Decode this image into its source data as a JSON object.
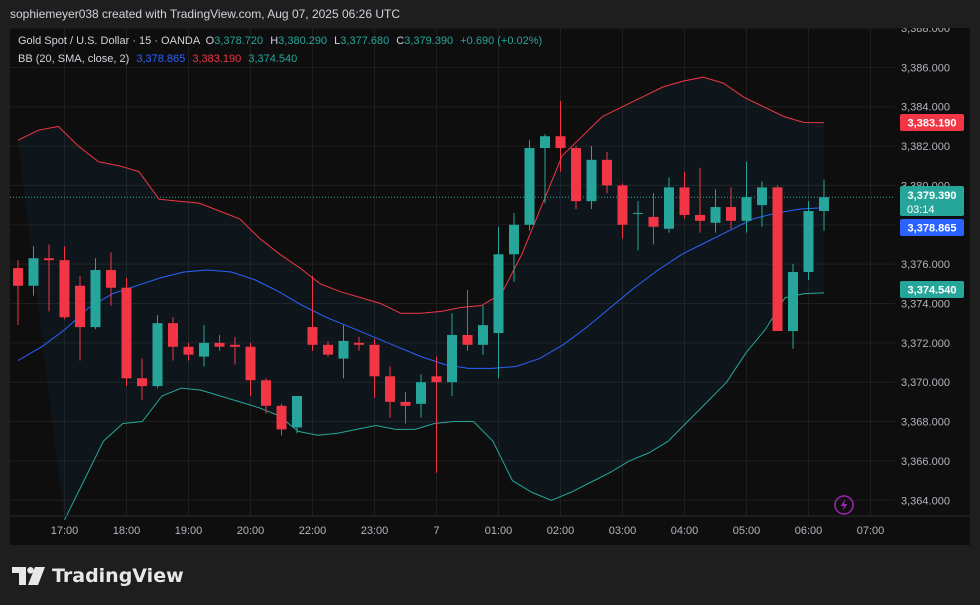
{
  "header": {
    "caption": "sophiemeyer038 created with TradingView.com, Aug 07, 2025 06:26 UTC"
  },
  "legend": {
    "symbol": "Gold Spot / U.S. Dollar · 15 · OANDA",
    "o_label": "O",
    "o_value": "3,378.720",
    "h_label": "H",
    "h_value": "3,380.290",
    "l_label": "L",
    "l_value": "3,377.680",
    "c_label": "C",
    "c_value": "3,379.390",
    "change": "+0.690 (+0.02%)",
    "bb_label": "BB (20, SMA, close, 2)",
    "bb_basis": "3,378.865",
    "bb_upper": "3,383.190",
    "bb_lower": "3,374.540"
  },
  "price_tags": {
    "upper": "3,383.190",
    "close": "3,379.390",
    "countdown": "03:14",
    "basis": "3,378.865",
    "lower": "3,374.540"
  },
  "colors": {
    "up": "#26a69a",
    "down": "#f23645",
    "basis": "#2962ff",
    "upper": "#f23645",
    "lower": "#26a69a",
    "axis_text": "#b2b5be",
    "flash_icon": "#9c27b0"
  },
  "footer": {
    "brand": "TradingView"
  },
  "chart_data": {
    "type": "candlestick",
    "y_ticks": [
      "3,364.000",
      "3,366.000",
      "3,368.000",
      "3,370.000",
      "3,372.000",
      "3,374.000",
      "3,376.000",
      "3,378.000",
      "3,380.000",
      "3,382.000",
      "3,384.000",
      "3,386.000",
      "3,388.000"
    ],
    "ylim": [
      3363.2,
      3388.0
    ],
    "x_ticks": [
      {
        "label": "17:00",
        "i": 3
      },
      {
        "label": "18:00",
        "i": 7
      },
      {
        "label": "19:00",
        "i": 11
      },
      {
        "label": "20:00",
        "i": 15
      },
      {
        "label": "22:00",
        "i": 19
      },
      {
        "label": "23:00",
        "i": 23
      },
      {
        "label": "7",
        "i": 27
      },
      {
        "label": "01:00",
        "i": 31
      },
      {
        "label": "02:00",
        "i": 35
      },
      {
        "label": "03:00",
        "i": 39
      },
      {
        "label": "04:00",
        "i": 43
      },
      {
        "label": "05:00",
        "i": 47
      },
      {
        "label": "06:00",
        "i": 51
      },
      {
        "label": "07:00",
        "i": 55
      }
    ],
    "candles": [
      {
        "o": 3375.8,
        "h": 3376.2,
        "l": 3372.9,
        "c": 3374.9
      },
      {
        "o": 3374.9,
        "h": 3376.9,
        "l": 3374.4,
        "c": 3376.3
      },
      {
        "o": 3376.3,
        "h": 3377.0,
        "l": 3373.6,
        "c": 3376.2
      },
      {
        "o": 3376.2,
        "h": 3376.9,
        "l": 3373.2,
        "c": 3373.3
      },
      {
        "o": 3374.9,
        "h": 3375.4,
        "l": 3371.1,
        "c": 3372.8
      },
      {
        "o": 3372.8,
        "h": 3376.3,
        "l": 3372.7,
        "c": 3375.7
      },
      {
        "o": 3375.7,
        "h": 3376.6,
        "l": 3373.9,
        "c": 3374.8
      },
      {
        "o": 3374.8,
        "h": 3375.3,
        "l": 3369.8,
        "c": 3370.2
      },
      {
        "o": 3370.2,
        "h": 3371.2,
        "l": 3369.1,
        "c": 3369.8
      },
      {
        "o": 3369.8,
        "h": 3373.4,
        "l": 3369.7,
        "c": 3373.0
      },
      {
        "o": 3373.0,
        "h": 3373.3,
        "l": 3371.1,
        "c": 3371.8
      },
      {
        "o": 3371.8,
        "h": 3372.0,
        "l": 3371.1,
        "c": 3371.4
      },
      {
        "o": 3371.3,
        "h": 3372.9,
        "l": 3370.8,
        "c": 3372.0
      },
      {
        "o": 3372.0,
        "h": 3372.4,
        "l": 3371.6,
        "c": 3371.8
      },
      {
        "o": 3371.9,
        "h": 3372.3,
        "l": 3370.9,
        "c": 3371.8
      },
      {
        "o": 3371.8,
        "h": 3372.0,
        "l": 3369.3,
        "c": 3370.1
      },
      {
        "o": 3370.1,
        "h": 3370.2,
        "l": 3368.4,
        "c": 3368.8
      },
      {
        "o": 3368.8,
        "h": 3368.9,
        "l": 3367.3,
        "c": 3367.6
      },
      {
        "o": 3367.7,
        "h": 3369.3,
        "l": 3367.4,
        "c": 3369.3
      },
      {
        "o": 3372.8,
        "h": 3375.4,
        "l": 3371.6,
        "c": 3371.9
      },
      {
        "o": 3371.9,
        "h": 3372.1,
        "l": 3371.3,
        "c": 3371.4
      },
      {
        "o": 3371.2,
        "h": 3372.9,
        "l": 3370.2,
        "c": 3372.1
      },
      {
        "o": 3372.0,
        "h": 3372.3,
        "l": 3371.6,
        "c": 3371.9
      },
      {
        "o": 3371.9,
        "h": 3372.2,
        "l": 3369.2,
        "c": 3370.3
      },
      {
        "o": 3370.3,
        "h": 3370.8,
        "l": 3368.2,
        "c": 3369.0
      },
      {
        "o": 3369.0,
        "h": 3369.5,
        "l": 3367.9,
        "c": 3368.8
      },
      {
        "o": 3368.9,
        "h": 3370.4,
        "l": 3368.2,
        "c": 3370.0
      },
      {
        "o": 3370.3,
        "h": 3371.3,
        "l": 3365.4,
        "c": 3370.0
      },
      {
        "o": 3370.0,
        "h": 3373.5,
        "l": 3369.3,
        "c": 3372.4
      },
      {
        "o": 3372.4,
        "h": 3374.7,
        "l": 3371.6,
        "c": 3371.9
      },
      {
        "o": 3371.9,
        "h": 3373.9,
        "l": 3371.4,
        "c": 3372.9
      },
      {
        "o": 3372.5,
        "h": 3377.9,
        "l": 3370.2,
        "c": 3376.5
      },
      {
        "o": 3376.5,
        "h": 3378.6,
        "l": 3375.1,
        "c": 3378.0
      },
      {
        "o": 3378.0,
        "h": 3382.3,
        "l": 3377.7,
        "c": 3381.9
      },
      {
        "o": 3381.9,
        "h": 3382.6,
        "l": 3379.1,
        "c": 3382.5
      },
      {
        "o": 3382.5,
        "h": 3384.3,
        "l": 3380.7,
        "c": 3381.9
      },
      {
        "o": 3381.9,
        "h": 3382.0,
        "l": 3378.8,
        "c": 3379.2
      },
      {
        "o": 3379.2,
        "h": 3382.0,
        "l": 3378.8,
        "c": 3381.3
      },
      {
        "o": 3381.3,
        "h": 3381.7,
        "l": 3379.6,
        "c": 3380.0
      },
      {
        "o": 3380.0,
        "h": 3380.1,
        "l": 3377.3,
        "c": 3378.0
      },
      {
        "o": 3378.6,
        "h": 3379.2,
        "l": 3376.7,
        "c": 3378.6
      },
      {
        "o": 3378.4,
        "h": 3379.6,
        "l": 3377.0,
        "c": 3377.9
      },
      {
        "o": 3377.8,
        "h": 3380.4,
        "l": 3377.6,
        "c": 3379.9
      },
      {
        "o": 3379.9,
        "h": 3380.7,
        "l": 3378.3,
        "c": 3378.5
      },
      {
        "o": 3378.5,
        "h": 3380.9,
        "l": 3377.6,
        "c": 3378.2
      },
      {
        "o": 3378.1,
        "h": 3379.8,
        "l": 3377.6,
        "c": 3378.9
      },
      {
        "o": 3378.9,
        "h": 3379.9,
        "l": 3377.8,
        "c": 3378.2
      },
      {
        "o": 3378.2,
        "h": 3381.2,
        "l": 3377.6,
        "c": 3379.4
      },
      {
        "o": 3379.0,
        "h": 3380.2,
        "l": 3377.9,
        "c": 3379.9
      },
      {
        "o": 3379.9,
        "h": 3380.0,
        "l": 3372.6,
        "c": 3372.6
      },
      {
        "o": 3372.6,
        "h": 3376.0,
        "l": 3371.7,
        "c": 3375.6
      },
      {
        "o": 3375.6,
        "h": 3379.2,
        "l": 3375.2,
        "c": 3378.7
      },
      {
        "o": 3378.7,
        "h": 3380.3,
        "l": 3377.7,
        "c": 3379.4
      }
    ],
    "bb_upper_approx": [
      3382.3,
      3382.8,
      3383.0,
      3382.0,
      3381.2,
      3381.0,
      3380.7,
      3379.3,
      3379.2,
      3379.1,
      3378.7,
      3378.3,
      3377.3,
      3376.5,
      3375.8,
      3375.0,
      3374.6,
      3374.3,
      3374.0,
      3373.5,
      3373.5,
      3373.6,
      3373.8,
      3373.9,
      3374.5,
      3376.5,
      3379.0,
      3381.5,
      3382.5,
      3383.5,
      3384.0,
      3384.5,
      3385.0,
      3385.3,
      3385.5,
      3385.2,
      3384.5,
      3384.0,
      3383.5,
      3383.2,
      3383.19
    ],
    "bb_basis_approx": [
      3371.1,
      3371.8,
      3372.7,
      3373.8,
      3374.5,
      3374.9,
      3375.3,
      3375.6,
      3375.7,
      3375.6,
      3375.2,
      3374.6,
      3373.9,
      3373.3,
      3372.8,
      3372.3,
      3371.8,
      3371.3,
      3370.9,
      3370.7,
      3370.7,
      3370.8,
      3371.2,
      3371.9,
      3372.8,
      3373.8,
      3374.8,
      3375.7,
      3376.5,
      3377.1,
      3377.7,
      3378.3,
      3378.6,
      3378.8,
      3378.865
    ],
    "bb_lower_approx": [
      3363.0,
      3365.0,
      3367.0,
      3367.9,
      3368.0,
      3369.3,
      3369.7,
      3369.6,
      3369.3,
      3369.0,
      3368.7,
      3368.3,
      3367.5,
      3367.3,
      3367.4,
      3367.6,
      3367.8,
      3367.6,
      3367.6,
      3367.9,
      3368.0,
      3368.0,
      3367.0,
      3365.0,
      3364.4,
      3364.0,
      3364.4,
      3364.9,
      3365.4,
      3366.0,
      3366.4,
      3367.0,
      3368.0,
      3369.0,
      3370.0,
      3371.5,
      3372.7,
      3374.3,
      3374.5,
      3374.54
    ],
    "bb_upper_range": [
      0,
      52
    ],
    "bb_basis_range": [
      0,
      52
    ],
    "bb_lower_range": [
      3,
      52
    ]
  }
}
